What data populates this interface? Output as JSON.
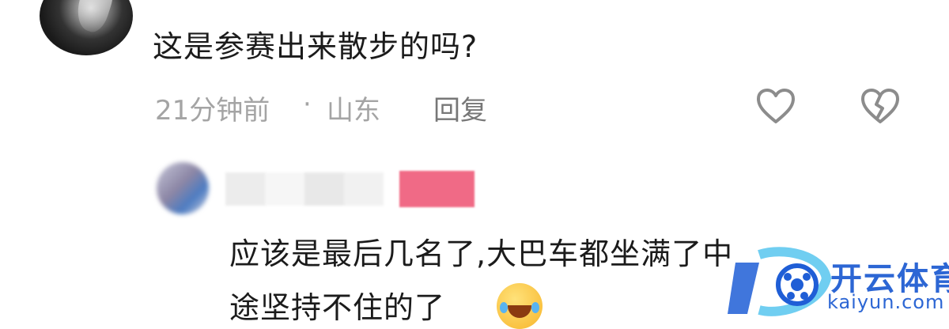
{
  "comment": {
    "text": "这是参赛出来散步的吗?",
    "time": "21分钟前",
    "separator": "·",
    "location": "山东",
    "reply_label": "回复",
    "icons": [
      "like-heart-icon",
      "dislike-broken-heart-icon"
    ]
  },
  "reply": {
    "lines": [
      "应该是最后几名了,大巴车都坐满了中",
      "途坚持不住的了"
    ],
    "emoji": "laughing-crying-emoji-icon"
  },
  "watermark": {
    "brand_cn": "开云体育",
    "brand_en": "kaiyun.com"
  },
  "colors": {
    "text": "#1b1b1b",
    "meta": "#a4a4a4",
    "brand": "#2c66d4",
    "badge": "#f06a86"
  }
}
